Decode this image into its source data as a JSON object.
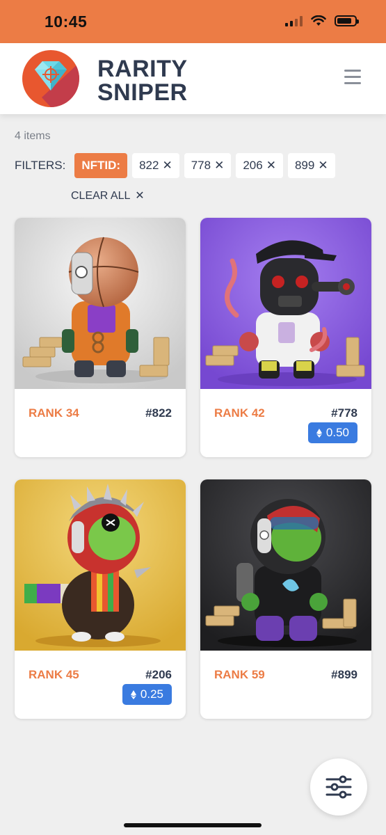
{
  "status_bar": {
    "time": "10:45"
  },
  "header": {
    "brand_line1": "RARITY",
    "brand_line2": "SNIPER"
  },
  "results": {
    "count": "4 items"
  },
  "filters": {
    "label": "FILTERS:",
    "field": "NFTID:",
    "chips": [
      "822",
      "778",
      "206",
      "899"
    ],
    "remove_glyph": "✕",
    "clear_all": "CLEAR ALL"
  },
  "cards": [
    {
      "rank": "RANK 34",
      "id": "#822",
      "price": ""
    },
    {
      "rank": "RANK 42",
      "id": "#778",
      "price": "0.50"
    },
    {
      "rank": "RANK 45",
      "id": "#206",
      "price": "0.25"
    },
    {
      "rank": "RANK 59",
      "id": "#899",
      "price": ""
    }
  ],
  "colors": {
    "accent": "#ec7c45",
    "price_badge": "#3a7be0",
    "text_dark": "#2f3a4f",
    "background": "#efefef"
  },
  "icons": {
    "logo": "diamond-crosshair-icon",
    "menu": "hamburger-menu-icon",
    "fab": "sliders-icon",
    "currency": "ethereum-icon"
  }
}
